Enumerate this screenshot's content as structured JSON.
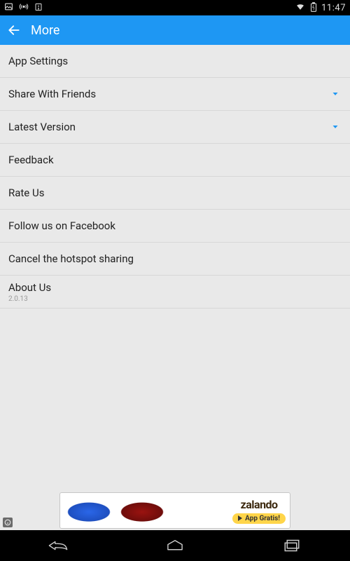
{
  "statusbar": {
    "time": "11:47"
  },
  "appbar": {
    "title": "More"
  },
  "list": {
    "items": [
      {
        "label": "App Settings",
        "expandable": false
      },
      {
        "label": "Share With Friends",
        "expandable": true
      },
      {
        "label": "Latest Version",
        "expandable": true
      },
      {
        "label": "Feedback",
        "expandable": false
      },
      {
        "label": "Rate Us",
        "expandable": false
      },
      {
        "label": "Follow us on Facebook",
        "expandable": false
      },
      {
        "label": "Cancel the hotspot sharing",
        "expandable": false
      },
      {
        "label": "About Us",
        "expandable": false,
        "sub": "2.0.13"
      }
    ]
  },
  "ad": {
    "brand": "zalando",
    "button": "App Gratis!"
  }
}
